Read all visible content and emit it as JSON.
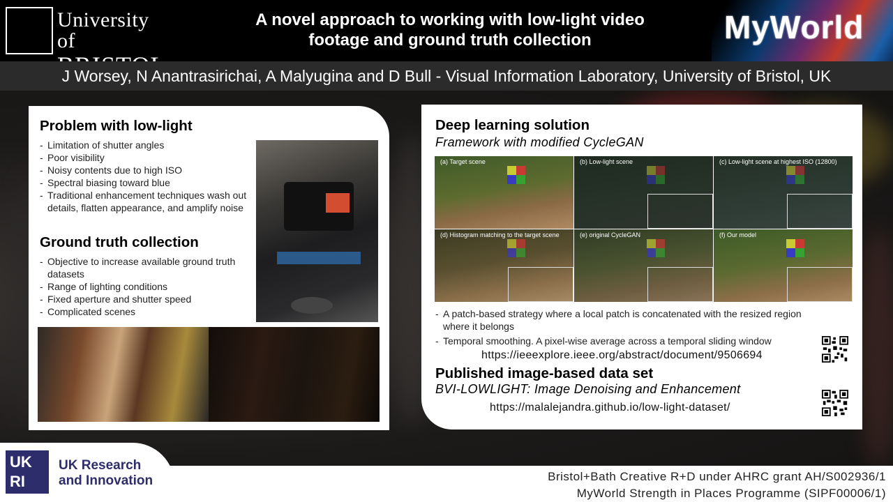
{
  "header": {
    "university_logo": {
      "line1": "University of",
      "line2": "BRISTOL"
    },
    "title_line1": "A novel approach to working with low-light video",
    "title_line2": "footage and ground truth collection",
    "partner_logo": "MyWorld"
  },
  "authors": "J Worsey, N Anantrasirichai, A Malyugina and D Bull - Visual Information Laboratory, University of Bristol, UK",
  "left_panel": {
    "problem": {
      "heading": "Problem with low-light",
      "bullets": [
        "Limitation of shutter angles",
        "Poor visibility",
        "Noisy contents due to high ISO",
        "Spectral biasing toward blue",
        "Traditional enhancement techniques wash out details, flatten appearance, and amplify noise"
      ]
    },
    "ground_truth": {
      "heading": "Ground truth collection",
      "bullets": [
        "Objective to increase  available  ground truth datasets",
        "Range of  lighting conditions",
        "Fixed aperture and shutter speed",
        "Complicated scenes"
      ]
    }
  },
  "right_panel": {
    "deep_learning": {
      "heading": "Deep learning solution",
      "subheading": "Framework with modified CycleGAN",
      "figure_labels": [
        "(a) Target scene",
        "(b) Low-light scene",
        "(c) Low-light scene at highest ISO (12800)",
        "(d) Histogram matching to the target scene",
        "(e) original CycleGAN",
        "(f) Our model"
      ],
      "bullets": [
        "A patch-based strategy where a local patch is concatenated with the resized region where it belongs",
        "Temporal smoothing. A pixel-wise average across a temporal sliding window"
      ],
      "url": "https://ieeexplore.ieee.org/abstract/document/9506694"
    },
    "dataset": {
      "heading": "Published image-based data set",
      "subheading": "BVI-LOWLIGHT:  Image Denoising and Enhancement",
      "url": "https://malalejandra.github.io/low-light-dataset/"
    }
  },
  "footer": {
    "ukri_line1": "UK Research",
    "ukri_line2": "and Innovation",
    "grant_line1": "Bristol+Bath Creative R+D under AHRC grant AH/S002936/1",
    "grant_line2": "MyWorld Strength in Places Programme (SIPF00006/1)"
  },
  "colors": {
    "ukri_navy": "#2e2d6b",
    "header_bg": "#000000",
    "author_bar": "#2b2b2b"
  }
}
